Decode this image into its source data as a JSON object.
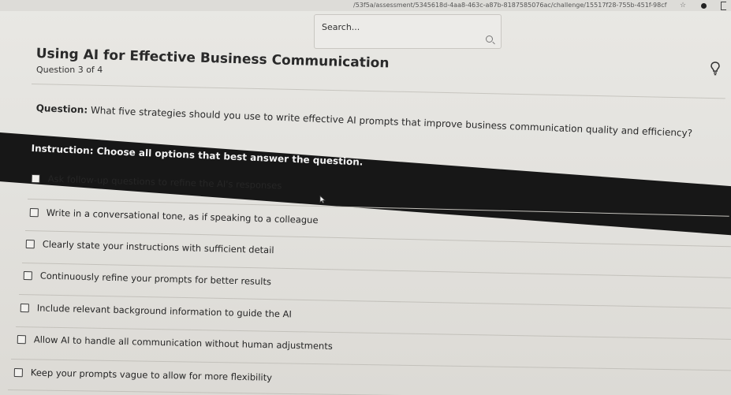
{
  "browser": {
    "url": "/53f5a/assessment/5345618d-4aa8-463c-a87b-8187585076ac/challenge/15517f28-755b-451f-98cf",
    "icons": [
      "star-icon",
      "profile-dot-icon",
      "extension-icon"
    ]
  },
  "search": {
    "placeholder": "Search..."
  },
  "header": {
    "title": "Using AI for Effective Business Communication",
    "progress": "Question 3 of 4",
    "hint_icon": "lightbulb-icon"
  },
  "question": {
    "label": "Question:",
    "text": "What five strategies should you use to write effective AI prompts that improve business communication quality and efficiency?"
  },
  "instruction": {
    "text": "Instruction: Choose all options that best answer the question."
  },
  "options": [
    {
      "label": "Ask follow-up questions to refine the AI's responses",
      "checked": false
    },
    {
      "label": "Write in a conversational tone, as if speaking to a colleague",
      "checked": false
    },
    {
      "label": "Clearly state your instructions with sufficient detail",
      "checked": false
    },
    {
      "label": "Continuously refine your prompts for better results",
      "checked": false
    },
    {
      "label": "Include relevant background information to guide the AI",
      "checked": false
    },
    {
      "label": "Allow AI to handle all communication without human adjustments",
      "checked": false
    },
    {
      "label": "Keep your prompts vague to allow for more flexibility",
      "checked": false
    }
  ],
  "colors": {
    "instruction_band": "#171717",
    "page_background": "#e6e4df"
  }
}
